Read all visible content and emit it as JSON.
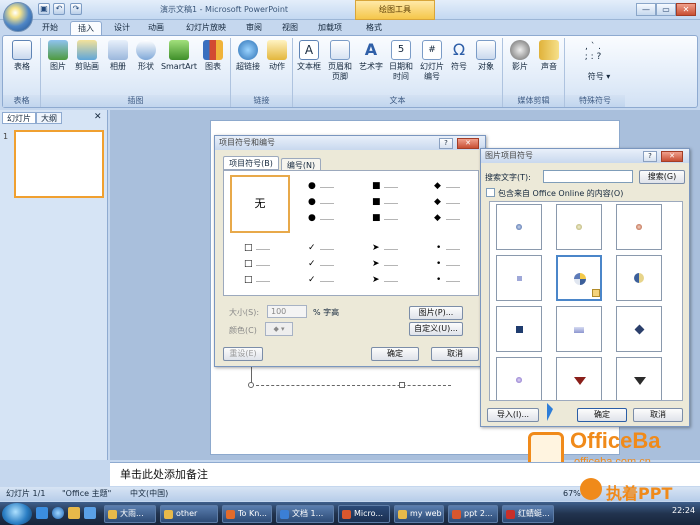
{
  "window": {
    "title": "演示文稿1 - Microsoft PowerPoint",
    "context_tab": "绘图工具"
  },
  "qat": {
    "save": "▣",
    "undo": "↶",
    "redo": "↷"
  },
  "tabs": [
    "开始",
    "插入",
    "设计",
    "动画",
    "幻灯片放映",
    "审阅",
    "视图",
    "加载项",
    "格式"
  ],
  "active_tab": "插入",
  "ribbon": {
    "groups": [
      {
        "label": "表格",
        "buttons": [
          "表格"
        ]
      },
      {
        "label": "插图",
        "buttons": [
          "图片",
          "剪贴画",
          "相册",
          "形状",
          "SmartArt",
          "图表"
        ]
      },
      {
        "label": "链接",
        "buttons": [
          "超链接",
          "动作"
        ]
      },
      {
        "label": "文本",
        "buttons": [
          "文本框",
          "页眉和页脚",
          "艺术字",
          "日期和时间",
          "幻灯片编号",
          "符号",
          "对象"
        ]
      },
      {
        "label": "媒体剪辑",
        "buttons": [
          "影片",
          "声音"
        ]
      },
      {
        "label": "特殊符号",
        "buttons": [
          "符号"
        ]
      }
    ]
  },
  "left_panel": {
    "tabs": [
      "幻灯片",
      "大纲"
    ],
    "close": "✕",
    "slide_number": "1"
  },
  "notes": {
    "placeholder": "单击此处添加备注"
  },
  "statusbar": {
    "slide": "幻灯片 1/1",
    "theme": "\"Office 主题\"",
    "lang": "中文(中国)",
    "zoom": "67%"
  },
  "bullet_dialog": {
    "title": "项目符号和编号",
    "tabs": [
      "项目符号(B)",
      "编号(N)"
    ],
    "none_label": "无",
    "size_label": "大小(S):",
    "size_value": "100",
    "size_unit": "% 字高",
    "color_label": "颜色(C)",
    "picture_button": "图片(P)...",
    "custom_button": "自定义(U)...",
    "reset_button": "重设(E)",
    "ok_button": "确定",
    "cancel_button": "取消"
  },
  "picture_dialog": {
    "title": "图片项目符号",
    "search_label": "搜索文字(T):",
    "search_value": "",
    "search_button": "搜索(G)",
    "checkbox_label": "包含来自 Office Online 的内容(O)",
    "import_button": "导入(I)...",
    "ok_button": "确定",
    "cancel_button": "取消"
  },
  "watermark": {
    "brand": "OfficeBa",
    "url": "officeba.com.cn",
    "brand2": "执着PPT"
  },
  "taskbar": {
    "items": [
      "大雨...",
      "other",
      "To Kn...",
      "文档 1...",
      "Micro...",
      "my web",
      "ppt 2...",
      "红蜻蜓..."
    ],
    "clock": "22:24"
  }
}
